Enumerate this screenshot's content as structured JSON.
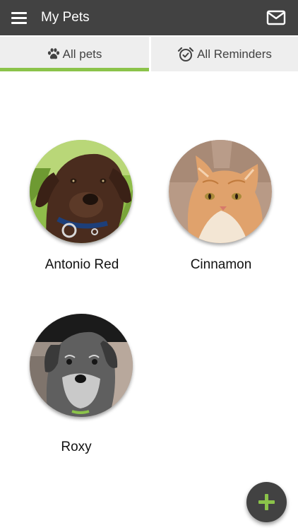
{
  "appbar": {
    "title": "My Pets",
    "menu_icon": "hamburger-menu-icon",
    "mail_icon": "mail-icon"
  },
  "tabs": [
    {
      "label": "All pets",
      "icon": "paw-icon",
      "selected": true
    },
    {
      "label": "All Reminders",
      "icon": "alarm-clock-icon",
      "selected": false
    }
  ],
  "colors": {
    "appbar": "#424242",
    "accent": "#8bc34a",
    "tab_background": "#eeeeee"
  },
  "pets": [
    {
      "name": "Antonio Red",
      "photo": "brown-labrador-puppy"
    },
    {
      "name": "Cinnamon",
      "photo": "orange-tabby-cat"
    },
    {
      "name": "Roxy",
      "photo": "grey-schnauzer-puppy"
    }
  ],
  "fab": {
    "icon": "plus-icon"
  }
}
